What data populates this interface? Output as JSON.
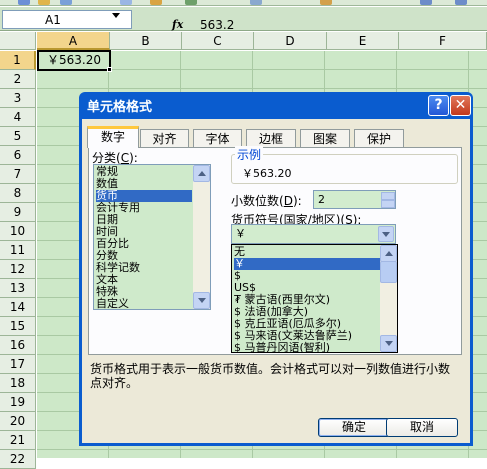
{
  "formula_bar": {
    "name_box": "A1",
    "fx_label": "fx",
    "value": "563.2"
  },
  "sheet": {
    "columns": [
      "A",
      "B",
      "C",
      "D",
      "E",
      "F"
    ],
    "rows": [
      "1",
      "2",
      "3",
      "4",
      "5",
      "6",
      "7",
      "8",
      "9",
      "10",
      "11",
      "12",
      "13",
      "14",
      "15",
      "16",
      "17",
      "18",
      "19",
      "20",
      "21",
      "22"
    ],
    "cell_a1": "￥563.20"
  },
  "dialog": {
    "title": "单元格格式",
    "help_label": "?",
    "close_label": "✕",
    "tabs": [
      "数字",
      "对齐",
      "字体",
      "边框",
      "图案",
      "保护"
    ],
    "category_label": "分类(",
    "category_key": "C",
    "category_label_end": "):",
    "categories": [
      "常规",
      "数值",
      "货币",
      "会计专用",
      "日期",
      "时间",
      "百分比",
      "分数",
      "科学记数",
      "文本",
      "特殊",
      "自定义"
    ],
    "selected_category_index": 2,
    "sample": {
      "title": "示例",
      "value": "￥563.20"
    },
    "decimal": {
      "label": "小数位数(",
      "key": "D",
      "label_end": "):",
      "value": "2"
    },
    "currency": {
      "label": "货币符号(国家/地区)(",
      "key": "S",
      "label_end": "):",
      "value": "￥",
      "options": [
        "无",
        "￥",
        "$",
        "US$",
        "₮ 蒙古语(西里尔文)",
        "$ 法语(加拿大)",
        "$ 克丘亚语(厄瓜多尔)",
        "$ 马来语(文莱达鲁萨兰)",
        "$ 马普丹冈语(智利)"
      ],
      "selected_index": 1
    },
    "description": "货币格式用于表示一般货币数值。会计格式可以对一列数值进行小数点对齐。",
    "ok_label": "确定",
    "cancel_label": "取消"
  },
  "colors": {
    "accent": "#0a5ccf",
    "selection": "#316ac5",
    "grid_fill": "#cde8c8"
  }
}
